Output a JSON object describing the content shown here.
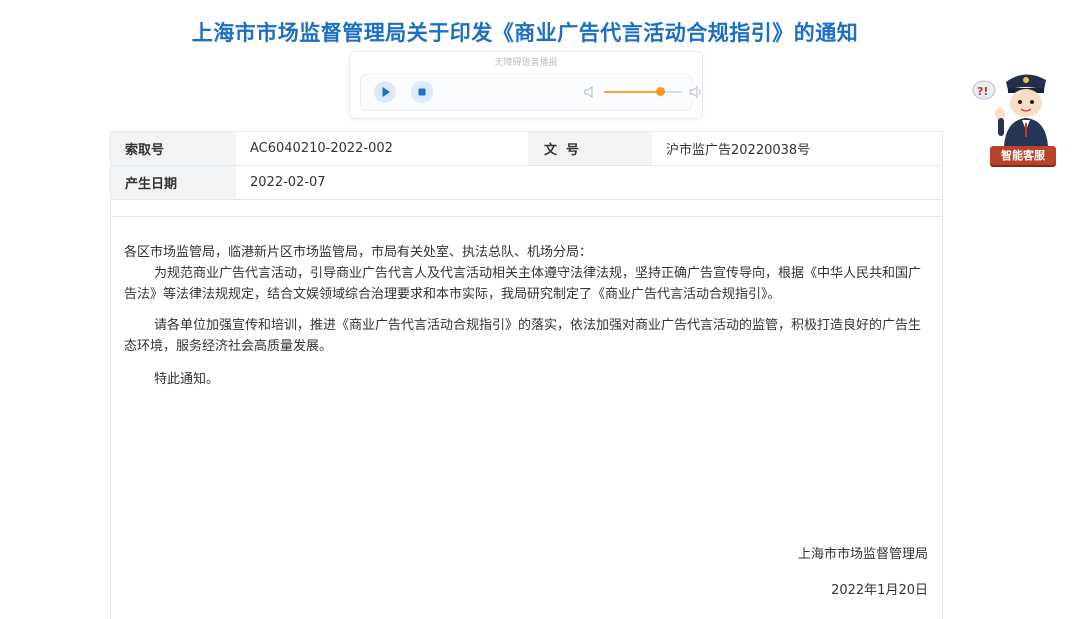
{
  "page": {
    "title": "上海市市场监督管理局关于印发《商业广告代言活动合规指引》的通知"
  },
  "player": {
    "label": "无障碍语音播报",
    "volume": 0.72,
    "accent_color": "#1c6fc6",
    "volume_color": "#f39a1f"
  },
  "mascot": {
    "label": "智能客服"
  },
  "meta": {
    "index_label": "索取号",
    "index_value": "AC6040210-2022-002",
    "docno_label": "文  号",
    "docno_value": "沪市监广告20220038号",
    "date_label": "产生日期",
    "date_value": "2022-02-07"
  },
  "body": {
    "salutation": "各区市场监管局，临港新片区市场监管局，市局有关处室、执法总队、机场分局：",
    "para1": "为规范商业广告代言活动，引导商业广告代言人及代言活动相关主体遵守法律法规，坚持正确广告宣传导向，根据《中华人民共和国广告法》等法律法规规定，结合文娱领域综合治理要求和本市实际，我局研究制定了《商业广告代言活动合规指引》。",
    "para2": "请各单位加强宣传和培训，推进《商业广告代言活动合规指引》的落实，依法加强对商业广告代言活动的监管，积极打造良好的广告生态环境，服务经济社会高质量发展。",
    "para3": "特此通知。"
  },
  "signature": {
    "org": "上海市市场监督管理局",
    "date": "2022年1月20日"
  }
}
